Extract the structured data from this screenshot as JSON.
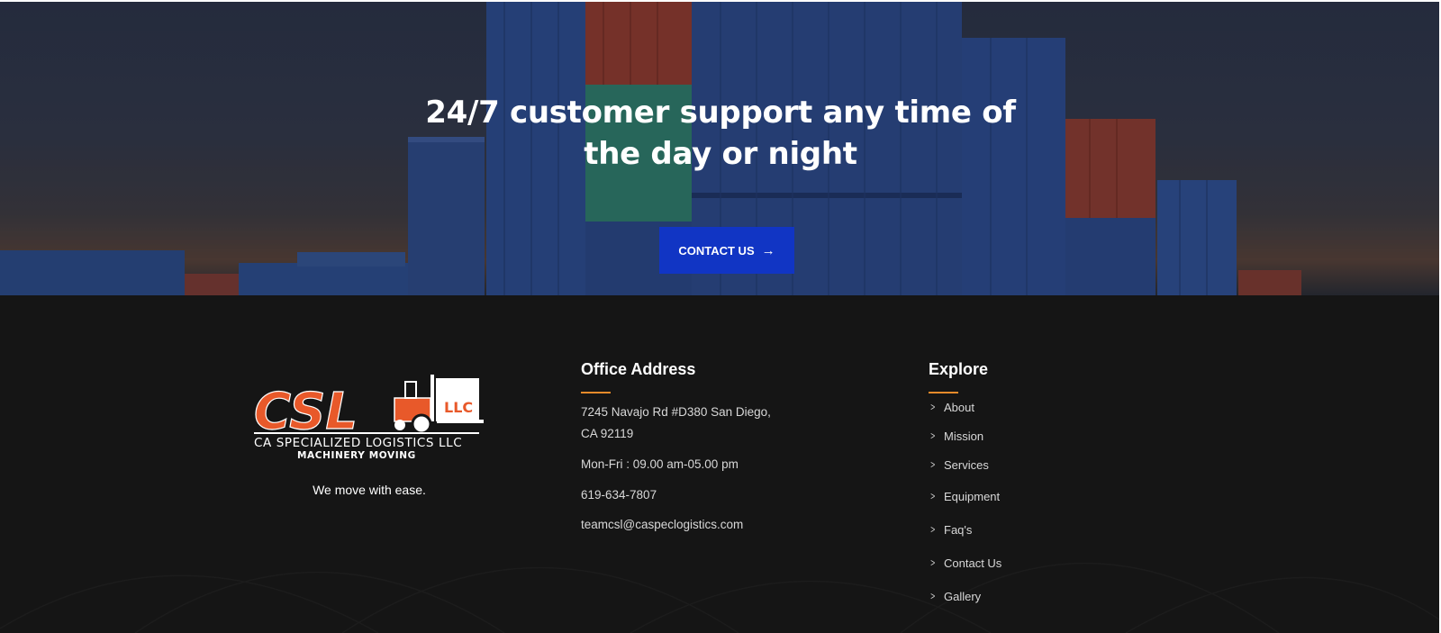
{
  "hero": {
    "title_line1": "24/7 customer support any time of",
    "title_line2": "the day or night",
    "cta_label": "CONTACT US",
    "cta_icon": "arrow-right-icon"
  },
  "brand": {
    "logo_text": "CSL",
    "logo_badge": "LLC",
    "logo_line1": "CA SPECIALIZED LOGISTICS LLC",
    "logo_line2": "MACHINERY MOVING",
    "tagline": "We move with ease."
  },
  "office": {
    "title": "Office Address",
    "address_line1": "7245 Navajo Rd #D380 San Diego,",
    "address_line2": "CA 92119",
    "hours": "Mon-Fri : 09.00 am-05.00 pm",
    "phone": "619-634-7807",
    "email": "teamcsl@caspeclogistics.com"
  },
  "explore": {
    "title": "Explore",
    "items": [
      {
        "label": "About"
      },
      {
        "label": "Mission"
      },
      {
        "label": "Services"
      },
      {
        "label": "Equipment"
      },
      {
        "label": "Faq's"
      },
      {
        "label": "Contact Us"
      },
      {
        "label": "Gallery"
      }
    ]
  },
  "colors": {
    "accent_orange": "#e8592a",
    "cta_blue": "#1135c4",
    "footer_bg": "#151515",
    "underline": "#e58a2a"
  }
}
